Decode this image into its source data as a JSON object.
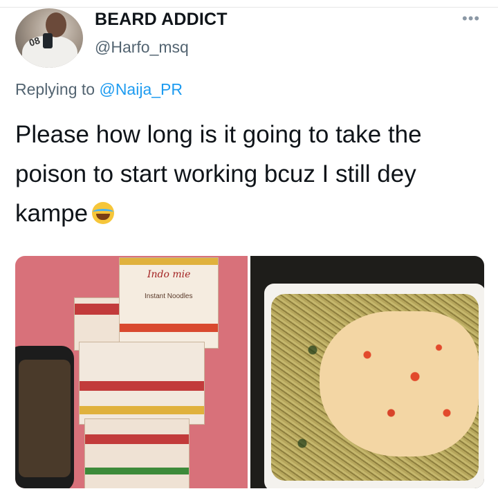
{
  "tweet": {
    "author_name": "BEARD ADDICT",
    "author_handle": "@Harfo_msq",
    "more_icon": "ellipsis-icon",
    "reply_prefix": "Replying to",
    "reply_mention": "@Naija_PR",
    "text": "Please how long is it going to take the poison to start working bcuz I still dey kampe",
    "emoji": "face-with-tears-of-joy",
    "mention_color": "#1d9bf0"
  },
  "media": {
    "left_photo": {
      "subject": "noodle-boxes",
      "box_logo": "Indo mie",
      "box_text": "Instant Noodles"
    },
    "right_photo": {
      "subject": "plate-of-noodles-and-eggs"
    }
  }
}
